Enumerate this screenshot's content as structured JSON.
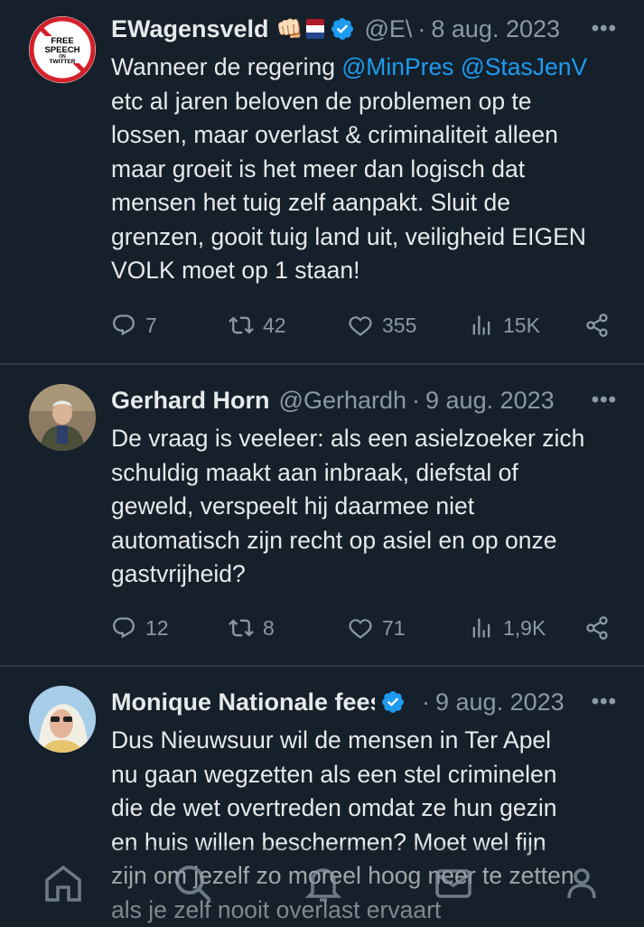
{
  "tweets": [
    {
      "name": "EWagensveld",
      "badge_text": "FREE\nSPEECH\nON\nTWITTER",
      "emoji": "👊🏻",
      "handle": "@E\\",
      "date": "8 aug. 2023",
      "body_prefix": "Wanneer de regering ",
      "mention1": "@MinPres",
      "mention2": "@StasJenV",
      "body_rest": "\netc al jaren beloven de problemen op te\nlossen, maar overlast & criminaliteit alleen\nmaar groeit is het meer dan logisch dat\nmensen het tuig zelf aanpakt. Sluit de\ngrenzen, gooit tuig land uit, veiligheid EIGEN\nVOLK moet op 1 staan!",
      "replies": "7",
      "retweets": "42",
      "likes": "355",
      "views": "15K"
    },
    {
      "name": "Gerhard Horn",
      "handle": "@Gerhardh",
      "date": "9 aug. 2023",
      "body": "De vraag is veeleer: als een asielzoeker zich\nschuldig maakt aan inbraak, diefstal of\ngeweld, verspeelt hij daarmee niet\nautomatisch zijn recht op asiel en op onze\ngastvrijheid?",
      "replies": "12",
      "retweets": "8",
      "likes": "71",
      "views": "1,9K"
    },
    {
      "name": "Monique Nationale feest",
      "date": "9 aug. 2023",
      "body": "Dus Nieuwsuur wil de mensen in Ter Apel\nnu gaan wegzetten als een stel criminelen\ndie de wet overtreden omdat ze hun gezin\nen huis willen beschermen? Moet wel fijn\nzijn om jezelf zo moreel hoog neer te zetten\nals je zelf nooit overlast ervaart"
    }
  ],
  "more_label": "•••",
  "sep": "·",
  "colors": {
    "background": "#15202b",
    "accent": "#1d9bf0",
    "muted": "#8b98a5"
  },
  "icons": [
    "reply-icon",
    "retweet-icon",
    "like-icon",
    "views-icon",
    "share-icon",
    "verified-icon",
    "home-icon",
    "search-icon",
    "notifications-icon",
    "messages-icon",
    "communities-icon"
  ]
}
